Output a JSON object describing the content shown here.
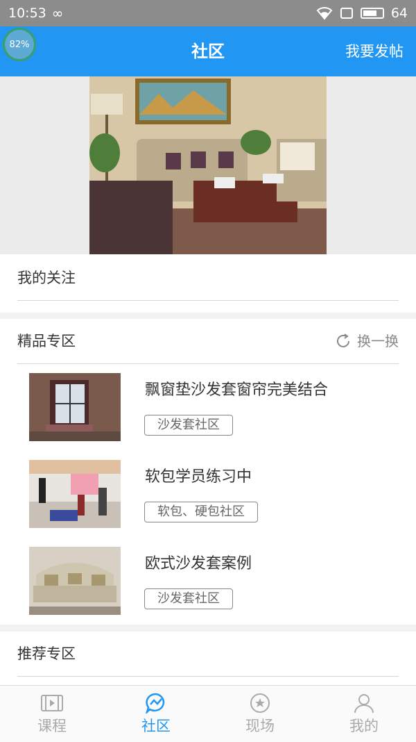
{
  "status": {
    "time": "10:53",
    "battery": "64"
  },
  "header": {
    "title": "社区",
    "post_label": "我要发帖",
    "badge": "82%"
  },
  "follow": {
    "title": "我的关注"
  },
  "featured": {
    "title": "精品专区",
    "refresh_label": "换一换",
    "items": [
      {
        "title": "飘窗垫沙发套窗帘完美结合",
        "tag": "沙发套社区"
      },
      {
        "title": "软包学员练习中",
        "tag": "软包、硬包社区"
      },
      {
        "title": "欧式沙发套案例",
        "tag": "沙发套社区"
      }
    ]
  },
  "recommend": {
    "title": "推荐专区"
  },
  "tabs": [
    {
      "label": "课程",
      "icon": "film-icon"
    },
    {
      "label": "社区",
      "icon": "community-chat-icon"
    },
    {
      "label": "现场",
      "icon": "scene-icon"
    },
    {
      "label": "我的",
      "icon": "person-icon"
    }
  ],
  "colors": {
    "accent": "#2196f3",
    "status_bar": "#8c8c8c"
  }
}
